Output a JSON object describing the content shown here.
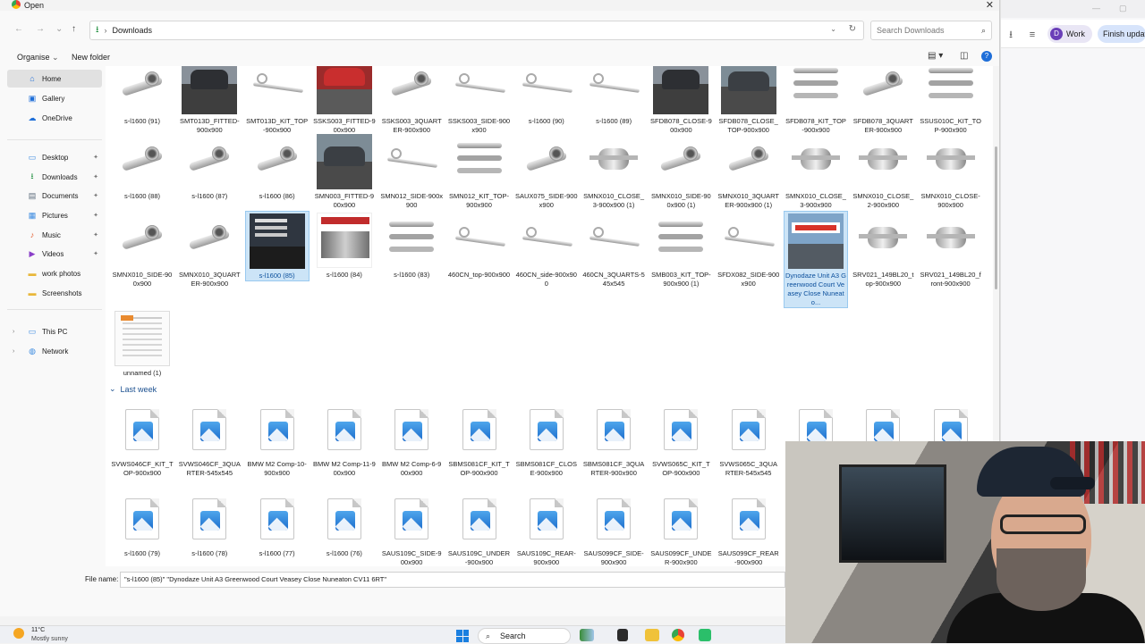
{
  "dialog": {
    "title": "Open",
    "close_glyph": "✕"
  },
  "address": {
    "back_glyph": "←",
    "forward_glyph": "→",
    "recent_glyph": "⌄",
    "up_glyph": "↑",
    "folder": "Downloads",
    "search_placeholder": "Search Downloads"
  },
  "commands": {
    "organise": "Organise",
    "new_folder": "New folder",
    "help": "?"
  },
  "sidebar": {
    "items": [
      {
        "label": "Home",
        "icon": "⌂",
        "color": "#1e6ed8"
      },
      {
        "label": "Gallery",
        "icon": "▣",
        "color": "#1e6ed8"
      },
      {
        "label": "OneDrive",
        "icon": "☁",
        "color": "#1e6ed8"
      },
      {
        "label": "Desktop",
        "icon": "▭",
        "color": "#3c8be0"
      },
      {
        "label": "Downloads",
        "icon": "⭳",
        "color": "#1a8c3a"
      },
      {
        "label": "Documents",
        "icon": "▤",
        "color": "#5a6a7a"
      },
      {
        "label": "Pictures",
        "icon": "▦",
        "color": "#3c8be0"
      },
      {
        "label": "Music",
        "icon": "♪",
        "color": "#e25a2b"
      },
      {
        "label": "Videos",
        "icon": "▶",
        "color": "#8a3fc8"
      },
      {
        "label": "work photos",
        "icon": "▬",
        "color": "#e8b73a"
      },
      {
        "label": "Screenshots",
        "icon": "▬",
        "color": "#e8b73a"
      },
      {
        "label": "This PC",
        "icon": "▭",
        "color": "#3c8be0"
      },
      {
        "label": "Network",
        "icon": "◍",
        "color": "#3c8be0"
      }
    ],
    "pin_glyph": "✦",
    "expand_glyph": "›"
  },
  "files": {
    "row1": [
      "s-l1600 (91)",
      "SMT013D_FITTED-900x900",
      "SMT013D_KIT_TOP-900x900",
      "SSKS003_FITTED-900x900",
      "SSKS003_3QUARTER-900x900",
      "SSKS003_SIDE-900x900",
      "s-l1600 (90)",
      "s-l1600 (89)",
      "SFDB078_CLOSE-900x900",
      "SFDB078_CLOSE_TOP-900x900",
      "SFDB078_KIT_TOP-900x900",
      "SFDB078_3QUARTER-900x900",
      "SSUS010C_KIT_TOP-900x900"
    ],
    "row2": [
      "s-l1600 (88)",
      "s-l1600 (87)",
      "s-l1600 (86)",
      "SMN003_FITTED-900x900",
      "SMN012_SIDE-900x900",
      "SMN012_KIT_TOP-900x900",
      "SAUX075_SIDE-900x900",
      "SMNX010_CLOSE_3-900x900 (1)",
      "SMNX010_SIDE-900x900 (1)",
      "SMNX010_3QUARTER-900x900 (1)",
      "SMNX010_CLOSE_3-900x900",
      "SMNX010_CLOSE_2-900x900",
      "SMNX010_CLOSE-900x900"
    ],
    "row3": [
      "SMNX010_SIDE-900x900",
      "SMNX010_3QUARTER-900x900",
      "s-l1600 (85)",
      "s-l1600 (84)",
      "s-l1600 (83)",
      "460CN_top-900x900",
      "460CN_side-900x900",
      "460CN_3QUARTS-545x545",
      "SMB003_KIT_TOP-900x900 (1)",
      "SFDX082_SIDE-900x900",
      "Dynodaze Unit A3 Greenwood Court Veasey Close Nuneato...",
      "SRV021_149BL20_top-900x900",
      "SRV021_149BL20_front-900x900"
    ],
    "row4": [
      "unnamed (1)"
    ],
    "group_label": "Last week",
    "row5": [
      "SVWS046CF_KIT_TOP-900x900",
      "SVWS046CF_3QUARTER-545x545",
      "BMW M2 Comp-10-900x900",
      "BMW M2 Comp-11-900x900",
      "BMW M2 Comp-6-900x900",
      "SBMS081CF_KIT_TOP-900x900",
      "SBMS081CF_CLOSE-900x900",
      "SBMS081CF_3QUARTER-900x900",
      "SVWS065C_KIT_TOP-900x900",
      "SVWS065C_3QUARTER-545x545",
      "",
      "",
      ""
    ],
    "row6": [
      "s-l1600 (79)",
      "s-l1600 (78)",
      "s-l1600 (77)",
      "s-l1600 (76)",
      "SAUS109C_SIDE-900x900",
      "SAUS109C_UNDER-900x900",
      "SAUS109C_REAR-900x900",
      "SAUS099CF_SIDE-900x900",
      "SAUS099CF_UNDER-900x900",
      "SAUS099CF_REAR-900x900"
    ]
  },
  "filename": {
    "label": "File name:",
    "value": "\"s-l1600 (85)\" \"Dynodaze Unit A3 Greenwood Court Veasey Close Nuneaton CV11 6RT\""
  },
  "browser": {
    "profile_initial": "D",
    "profile_label": "Work",
    "finish_label": "Finish update"
  },
  "taskbar": {
    "temp": "11°C",
    "weather": "Mostly sunny",
    "search": "Search"
  }
}
